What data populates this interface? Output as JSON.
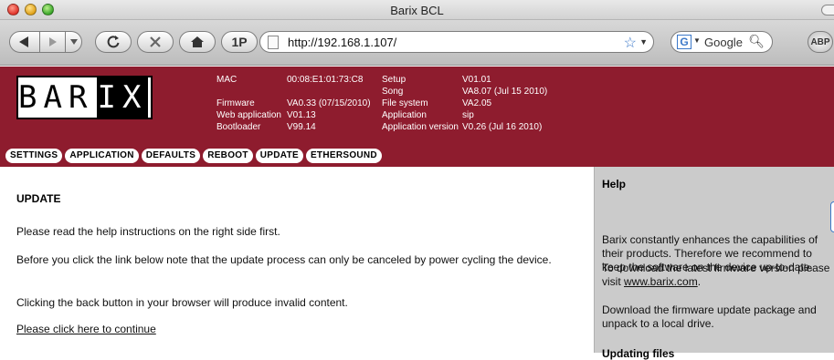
{
  "browser": {
    "window_title": "Barix BCL",
    "url": "http://192.168.1.107/",
    "onep_label": "1P",
    "search_label": "Google",
    "search_engine_letter": "G",
    "addon_label": "ABP"
  },
  "header": {
    "logo": "BARIX",
    "info_col1_labels": [
      "MAC",
      "Firmware",
      "Web application",
      "Bootloader"
    ],
    "info_col1_values": [
      "00:08:E1:01:73:C8",
      "VA0.33 (07/15/2010)",
      "V01.13",
      "V99.14"
    ],
    "info_col2_labels": [
      "Setup",
      "Song",
      "File system",
      "Application",
      "Application version"
    ],
    "info_col2_values": [
      "V01.01",
      "VA8.07 (Jul 15 2010)",
      "VA2.05",
      "sip",
      "V0.26 (Jul 16 2010)"
    ]
  },
  "menu": {
    "items": [
      "SETTINGS",
      "APPLICATION",
      "DEFAULTS",
      "REBOOT",
      "UPDATE",
      "ETHERSOUND"
    ]
  },
  "main": {
    "title": "UPDATE",
    "p1": "Please read the help instructions on the right side first.",
    "p2": "Before you click the link below note that the update process can only be canceled by power cycling the device.",
    "p3": "Clicking the back button in your browser will produce invalid content.",
    "link": "Please click here to continue"
  },
  "help": {
    "title": "Help",
    "p1": "Barix constantly enhances the capabilities of their products. Therefore we recommend to keep the software on the device up-to-date.",
    "p1b_prefix": "To download the latest firmware version please visit ",
    "p1b_link": "www.barix.com",
    "p1b_suffix": ".",
    "p2": "Download the firmware update package and unpack to a local drive.",
    "sub_title": "Updating files"
  },
  "colors": {
    "header_bg": "#8e1c2e",
    "help_bg": "#cbcbcb"
  }
}
